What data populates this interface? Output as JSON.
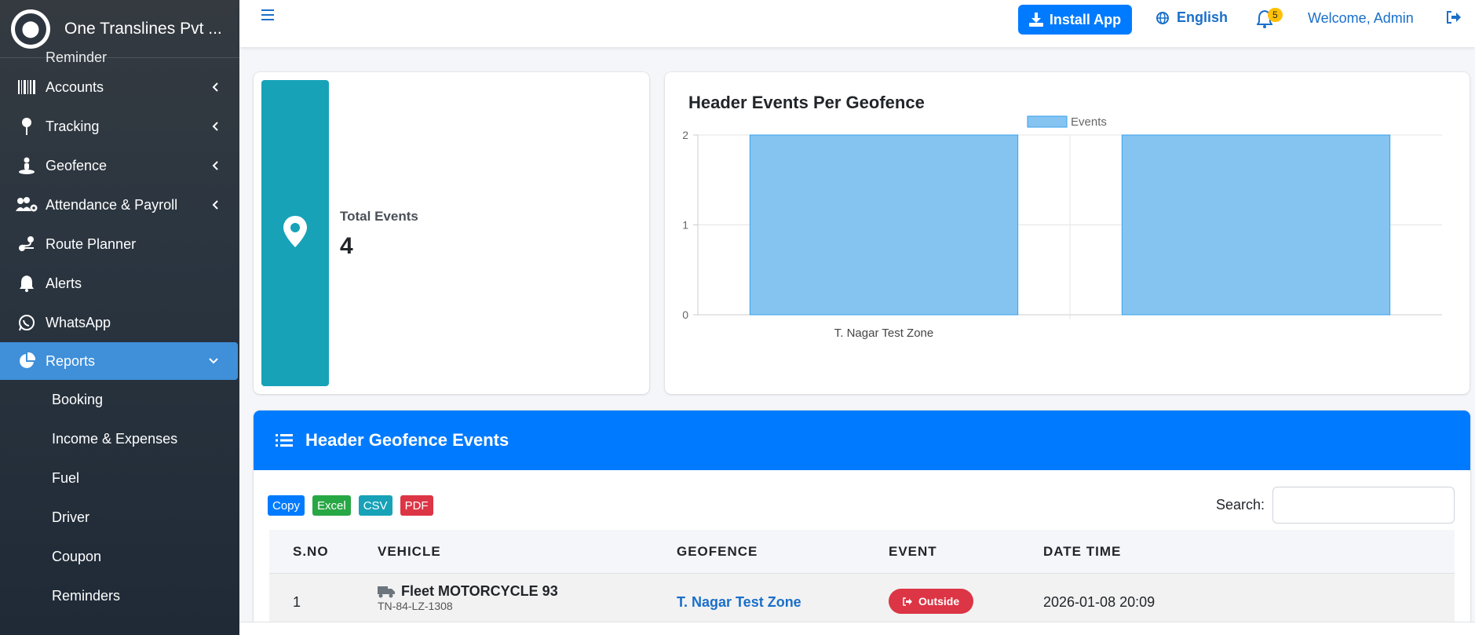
{
  "brand": {
    "name": "One Translines Pvt ..."
  },
  "sidebar": {
    "partial_item": "Reminder",
    "items": [
      {
        "label": "Accounts",
        "icon": "barcode-icon",
        "expandable": true
      },
      {
        "label": "Tracking",
        "icon": "map-pin-icon",
        "expandable": true
      },
      {
        "label": "Geofence",
        "icon": "street-view-icon",
        "expandable": true
      },
      {
        "label": "Attendance & Payroll",
        "icon": "users-cog-icon",
        "expandable": true
      },
      {
        "label": "Route Planner",
        "icon": "route-icon",
        "expandable": false
      },
      {
        "label": "Alerts",
        "icon": "bell-icon",
        "expandable": false
      },
      {
        "label": "WhatsApp",
        "icon": "whatsapp-icon",
        "expandable": false
      },
      {
        "label": "Reports",
        "icon": "pie-chart-icon",
        "expandable": true,
        "active": true
      }
    ],
    "sub_items": [
      "Booking",
      "Income & Expenses",
      "Fuel",
      "Driver",
      "Coupon",
      "Reminders"
    ]
  },
  "topbar": {
    "install_label": "Install App",
    "language": "English",
    "notification_count": "5",
    "welcome": "Welcome, Admin"
  },
  "summary": {
    "label": "Total Events",
    "value": "4"
  },
  "chart_title": "Header Events Per Geofence",
  "chart_data": {
    "type": "bar",
    "title": "Header Events Per Geofence",
    "categories": [
      "T. Nagar Test Zone",
      ""
    ],
    "series": [
      {
        "name": "Events",
        "values": [
          2,
          2
        ]
      }
    ],
    "yticks": [
      "0",
      "1",
      "2"
    ],
    "ylim": [
      0,
      2
    ],
    "legend": "top",
    "grid": true,
    "colors": {
      "fill": "#85c4f1",
      "stroke": "#36a2eb"
    }
  },
  "table": {
    "title": "Header Geofence Events",
    "export_buttons": {
      "copy": "Copy",
      "excel": "Excel",
      "csv": "CSV",
      "pdf": "PDF"
    },
    "search_label": "Search:",
    "columns": {
      "sno": "S.NO",
      "vehicle": "VEHICLE",
      "geofence": "GEOFENCE",
      "event": "EVENT",
      "datetime": "DATE TIME"
    },
    "rows": [
      {
        "sno": "1",
        "vehicle": "Fleet MOTORCYCLE 93",
        "plate": "TN-84-LZ-1308",
        "geofence": "T. Nagar Test Zone",
        "event": "Outside",
        "datetime": "2026-01-08 20:09"
      }
    ]
  },
  "colors": {
    "primary": "#007bff",
    "info": "#17a2b8",
    "danger": "#dc3545",
    "success": "#28a745",
    "sidebar": "#343a40"
  }
}
